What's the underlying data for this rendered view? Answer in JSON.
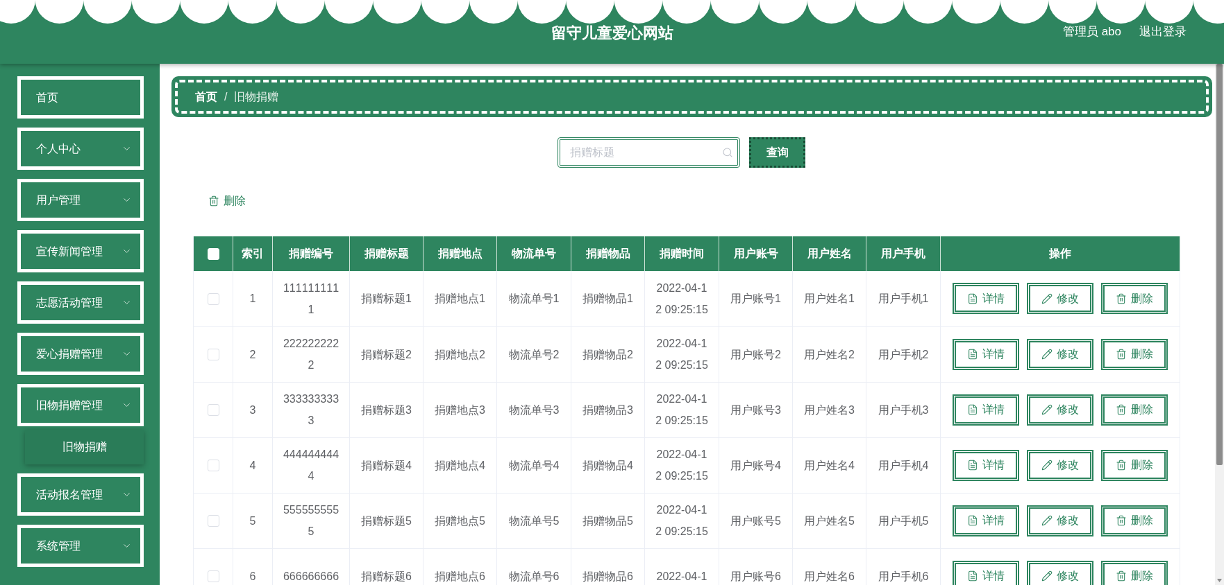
{
  "header": {
    "title": "留守儿童爱心网站",
    "user": "管理员 abo",
    "logout": "退出登录"
  },
  "sidebar": {
    "items": [
      {
        "label": "首页",
        "kind": "link",
        "selected": false
      },
      {
        "label": "个人中心",
        "kind": "submenu",
        "selected": false
      },
      {
        "label": "用户管理",
        "kind": "submenu",
        "selected": false
      },
      {
        "label": "宣传新闻管理",
        "kind": "submenu",
        "selected": false
      },
      {
        "label": "志愿活动管理",
        "kind": "submenu",
        "selected": false
      },
      {
        "label": "爱心捐赠管理",
        "kind": "submenu",
        "selected": false
      },
      {
        "label": "旧物捐赠管理",
        "kind": "submenu",
        "expanded": true,
        "selected": false,
        "children": [
          {
            "label": "旧物捐赠",
            "selected": true
          }
        ]
      },
      {
        "label": "活动报名管理",
        "kind": "submenu",
        "selected": false
      },
      {
        "label": "系统管理",
        "kind": "submenu",
        "selected": false
      }
    ]
  },
  "breadcrumb": {
    "items": [
      "首页",
      "旧物捐赠"
    ],
    "separator": "/"
  },
  "search": {
    "placeholder": "捐赠标题",
    "button": "查询"
  },
  "toolbar": {
    "kind": "delete",
    "label": "删除"
  },
  "table": {
    "select_all": {
      "checked": false
    },
    "columns": [
      "索引",
      "捐赠编号",
      "捐赠标题",
      "捐赠地点",
      "物流单号",
      "捐赠物品",
      "捐赠时间",
      "用户账号",
      "用户姓名",
      "用户手机",
      "操作"
    ],
    "rows": [
      {
        "checked": false,
        "cells": [
          "1",
          "1111111111",
          "捐赠标题1",
          "捐赠地点1",
          "物流单号1",
          "捐赠物品1",
          "2022-04-12 09:25:15",
          "用户账号1",
          "用户姓名1",
          "用户手机1"
        ],
        "actions": [
          {
            "kind": "detail",
            "label": "详情"
          },
          {
            "kind": "edit",
            "label": "修改"
          },
          {
            "kind": "delete",
            "label": "删除"
          }
        ]
      },
      {
        "checked": false,
        "cells": [
          "2",
          "2222222222",
          "捐赠标题2",
          "捐赠地点2",
          "物流单号2",
          "捐赠物品2",
          "2022-04-12 09:25:15",
          "用户账号2",
          "用户姓名2",
          "用户手机2"
        ],
        "actions": [
          {
            "kind": "detail",
            "label": "详情"
          },
          {
            "kind": "edit",
            "label": "修改"
          },
          {
            "kind": "delete",
            "label": "删除"
          }
        ]
      },
      {
        "checked": false,
        "cells": [
          "3",
          "3333333333",
          "捐赠标题3",
          "捐赠地点3",
          "物流单号3",
          "捐赠物品3",
          "2022-04-12 09:25:15",
          "用户账号3",
          "用户姓名3",
          "用户手机3"
        ],
        "actions": [
          {
            "kind": "detail",
            "label": "详情"
          },
          {
            "kind": "edit",
            "label": "修改"
          },
          {
            "kind": "delete",
            "label": "删除"
          }
        ]
      },
      {
        "checked": false,
        "cells": [
          "4",
          "4444444444",
          "捐赠标题4",
          "捐赠地点4",
          "物流单号4",
          "捐赠物品4",
          "2022-04-12 09:25:15",
          "用户账号4",
          "用户姓名4",
          "用户手机4"
        ],
        "actions": [
          {
            "kind": "detail",
            "label": "详情"
          },
          {
            "kind": "edit",
            "label": "修改"
          },
          {
            "kind": "delete",
            "label": "删除"
          }
        ]
      },
      {
        "checked": false,
        "cells": [
          "5",
          "5555555555",
          "捐赠标题5",
          "捐赠地点5",
          "物流单号5",
          "捐赠物品5",
          "2022-04-12 09:25:15",
          "用户账号5",
          "用户姓名5",
          "用户手机5"
        ],
        "actions": [
          {
            "kind": "detail",
            "label": "详情"
          },
          {
            "kind": "edit",
            "label": "修改"
          },
          {
            "kind": "delete",
            "label": "删除"
          }
        ]
      },
      {
        "checked": false,
        "cells": [
          "6",
          "666666666",
          "捐赠标题6",
          "捐赠地点6",
          "物流单号6",
          "捐赠物品6",
          "2022-04-1",
          "用户账号6",
          "用户姓名6",
          "用户手机6"
        ],
        "actions": [
          {
            "kind": "detail",
            "label": "详情"
          },
          {
            "kind": "edit",
            "label": "修改"
          },
          {
            "kind": "delete",
            "label": "删除"
          }
        ]
      }
    ]
  }
}
